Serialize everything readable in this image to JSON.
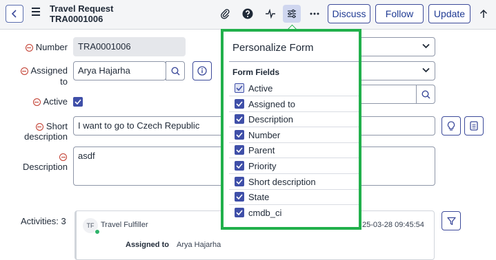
{
  "header": {
    "title": "Travel Request",
    "number": "TRA0001006",
    "buttons": {
      "discuss": "Discuss",
      "follow": "Follow",
      "update": "Update"
    },
    "icons": [
      "paperclip-icon",
      "help-icon",
      "activity-icon",
      "personalize-icon",
      "more-icon",
      "arrow-up-icon"
    ]
  },
  "form": {
    "number": {
      "label": "Number",
      "value": "TRA0001006"
    },
    "assigned_to": {
      "label_line1": "Assigned",
      "label_line2": "to",
      "value": "Arya Hajarha"
    },
    "active": {
      "label": "Active",
      "checked": true
    },
    "short_description": {
      "label_line1": "Short",
      "label_line2": "description",
      "value": "I want to go to Czech Republic"
    },
    "description": {
      "label": "Description",
      "value": "asdf"
    }
  },
  "activities": {
    "label": "Activities: 3",
    "entry": {
      "initials": "TF",
      "author": "Travel Fulfiller",
      "timestamp": "25-03-28 09:45:54",
      "field": "Assigned to",
      "value": "Arya Hajarha"
    }
  },
  "popup": {
    "title": "Personalize Form",
    "subtitle": "Form Fields",
    "fields": [
      {
        "label": "Active",
        "checked": true
      },
      {
        "label": "Assigned to",
        "checked": true
      },
      {
        "label": "Description",
        "checked": true
      },
      {
        "label": "Number",
        "checked": true
      },
      {
        "label": "Parent",
        "checked": true
      },
      {
        "label": "Priority",
        "checked": true
      },
      {
        "label": "Short description",
        "checked": true
      },
      {
        "label": "State",
        "checked": true
      },
      {
        "label": "cmdb_ci",
        "checked": true
      }
    ]
  },
  "colors": {
    "accent": "#3f4fa8",
    "highlight_border": "#21b04b",
    "required": "#c0392b"
  }
}
